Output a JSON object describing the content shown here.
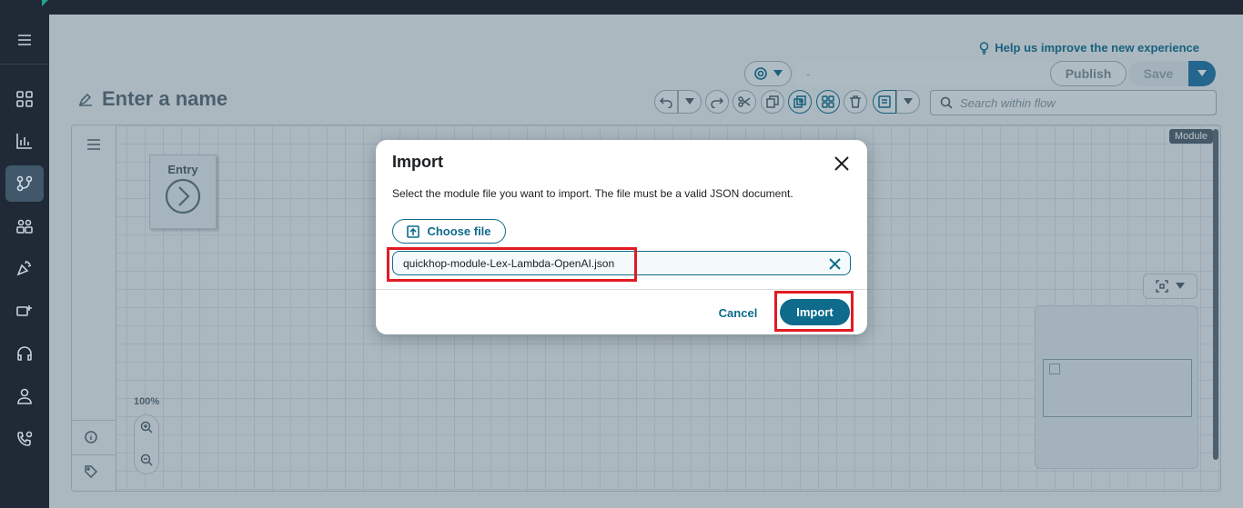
{
  "header": {
    "help_link": "Help us improve the new experience",
    "flow_name_placeholder": "Enter a name",
    "select_value": "-",
    "publish_label": "Publish",
    "save_label": "Save",
    "search_placeholder": "Search within flow"
  },
  "sidebar": {
    "items": [
      {
        "icon": "menu-icon"
      },
      {
        "icon": "dashboard-icon"
      },
      {
        "icon": "analytics-icon"
      },
      {
        "icon": "routing-icon",
        "active": true
      },
      {
        "icon": "users-icon"
      },
      {
        "icon": "campaign-icon"
      },
      {
        "icon": "channels-icon"
      },
      {
        "icon": "headset-icon"
      },
      {
        "icon": "user-icon"
      },
      {
        "icon": "phone-icon"
      }
    ]
  },
  "canvas": {
    "module_tag": "Module",
    "entry_label": "Entry",
    "zoom_level": "100%"
  },
  "modal": {
    "title": "Import",
    "description": "Select the module file you want to import. The file must be a valid JSON document.",
    "choose_file_label": "Choose file",
    "file_name": "quickhop-module-Lex-Lambda-OpenAI.json",
    "cancel_label": "Cancel",
    "import_label": "Import"
  },
  "colors": {
    "accent": "#0e6b8c",
    "highlight": "#e01b24",
    "nav_bg": "#1f2a36"
  }
}
